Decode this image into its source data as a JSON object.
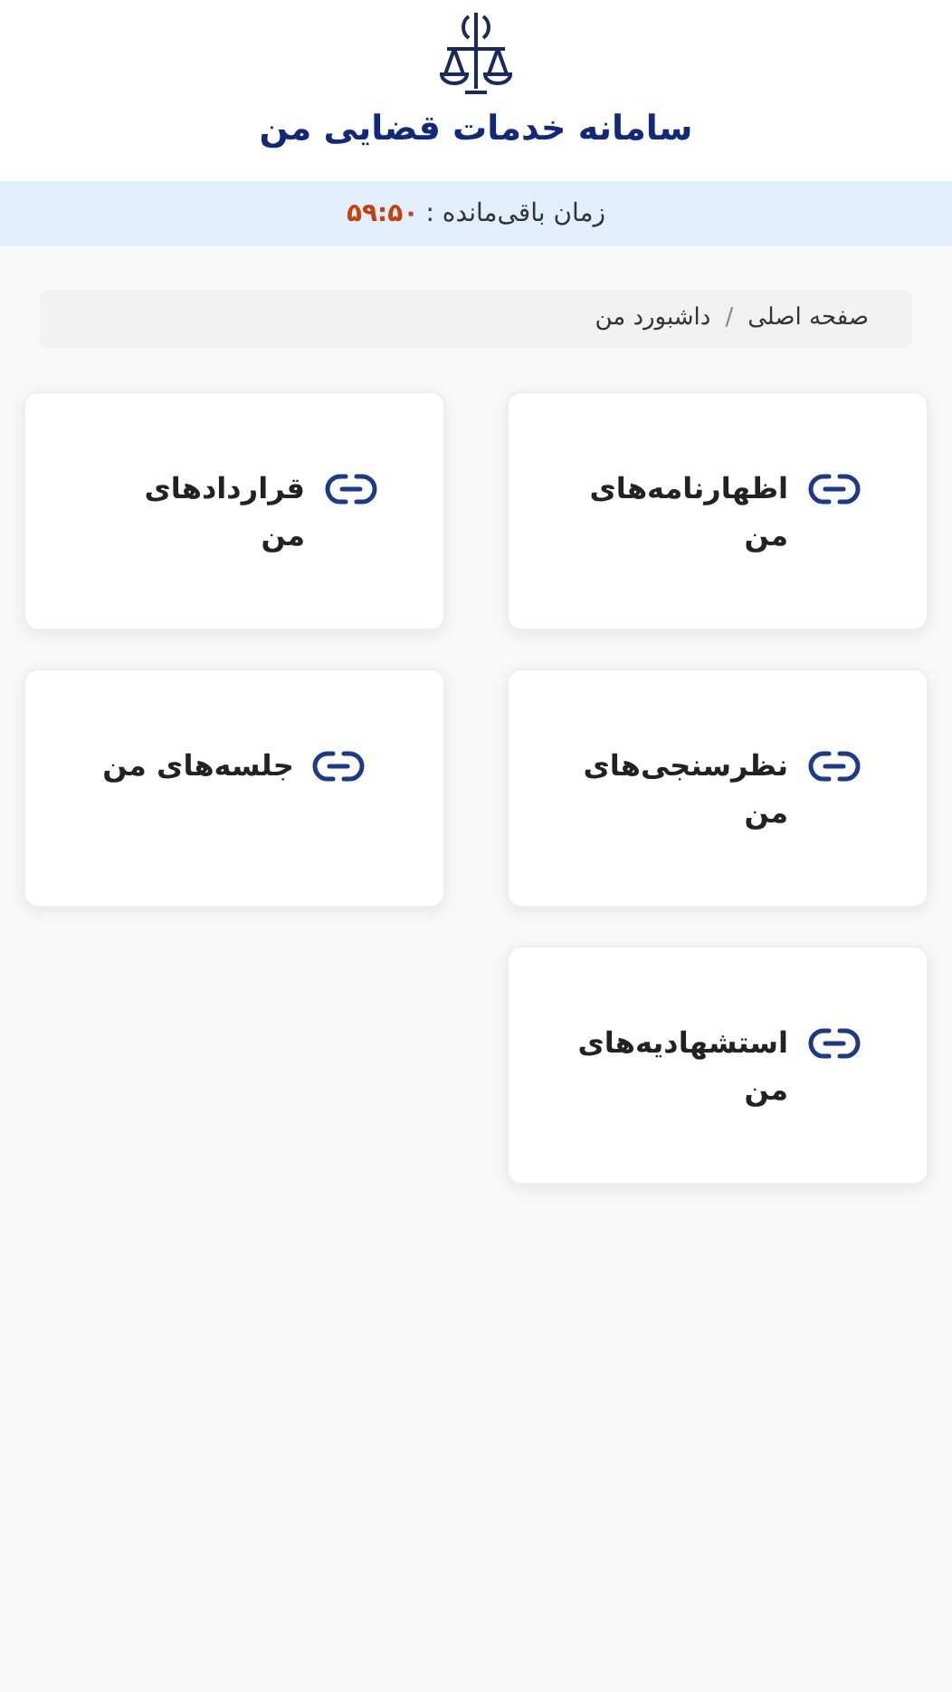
{
  "header": {
    "title": "سامانه خدمات قضایی من"
  },
  "timer": {
    "label": "زمان باقی‌مانده :",
    "value": "۵۹:۵۰"
  },
  "breadcrumb": [
    "صفحه اصلی",
    "/",
    "داشبورد من"
  ],
  "cards": [
    {
      "label": "اظهارنامه‌های من"
    },
    {
      "label": "قراردادهای من"
    },
    {
      "label": "نظرسنجی‌های من"
    },
    {
      "label": "جلسه‌های من"
    },
    {
      "label": "استشهادیه‌های من"
    }
  ]
}
